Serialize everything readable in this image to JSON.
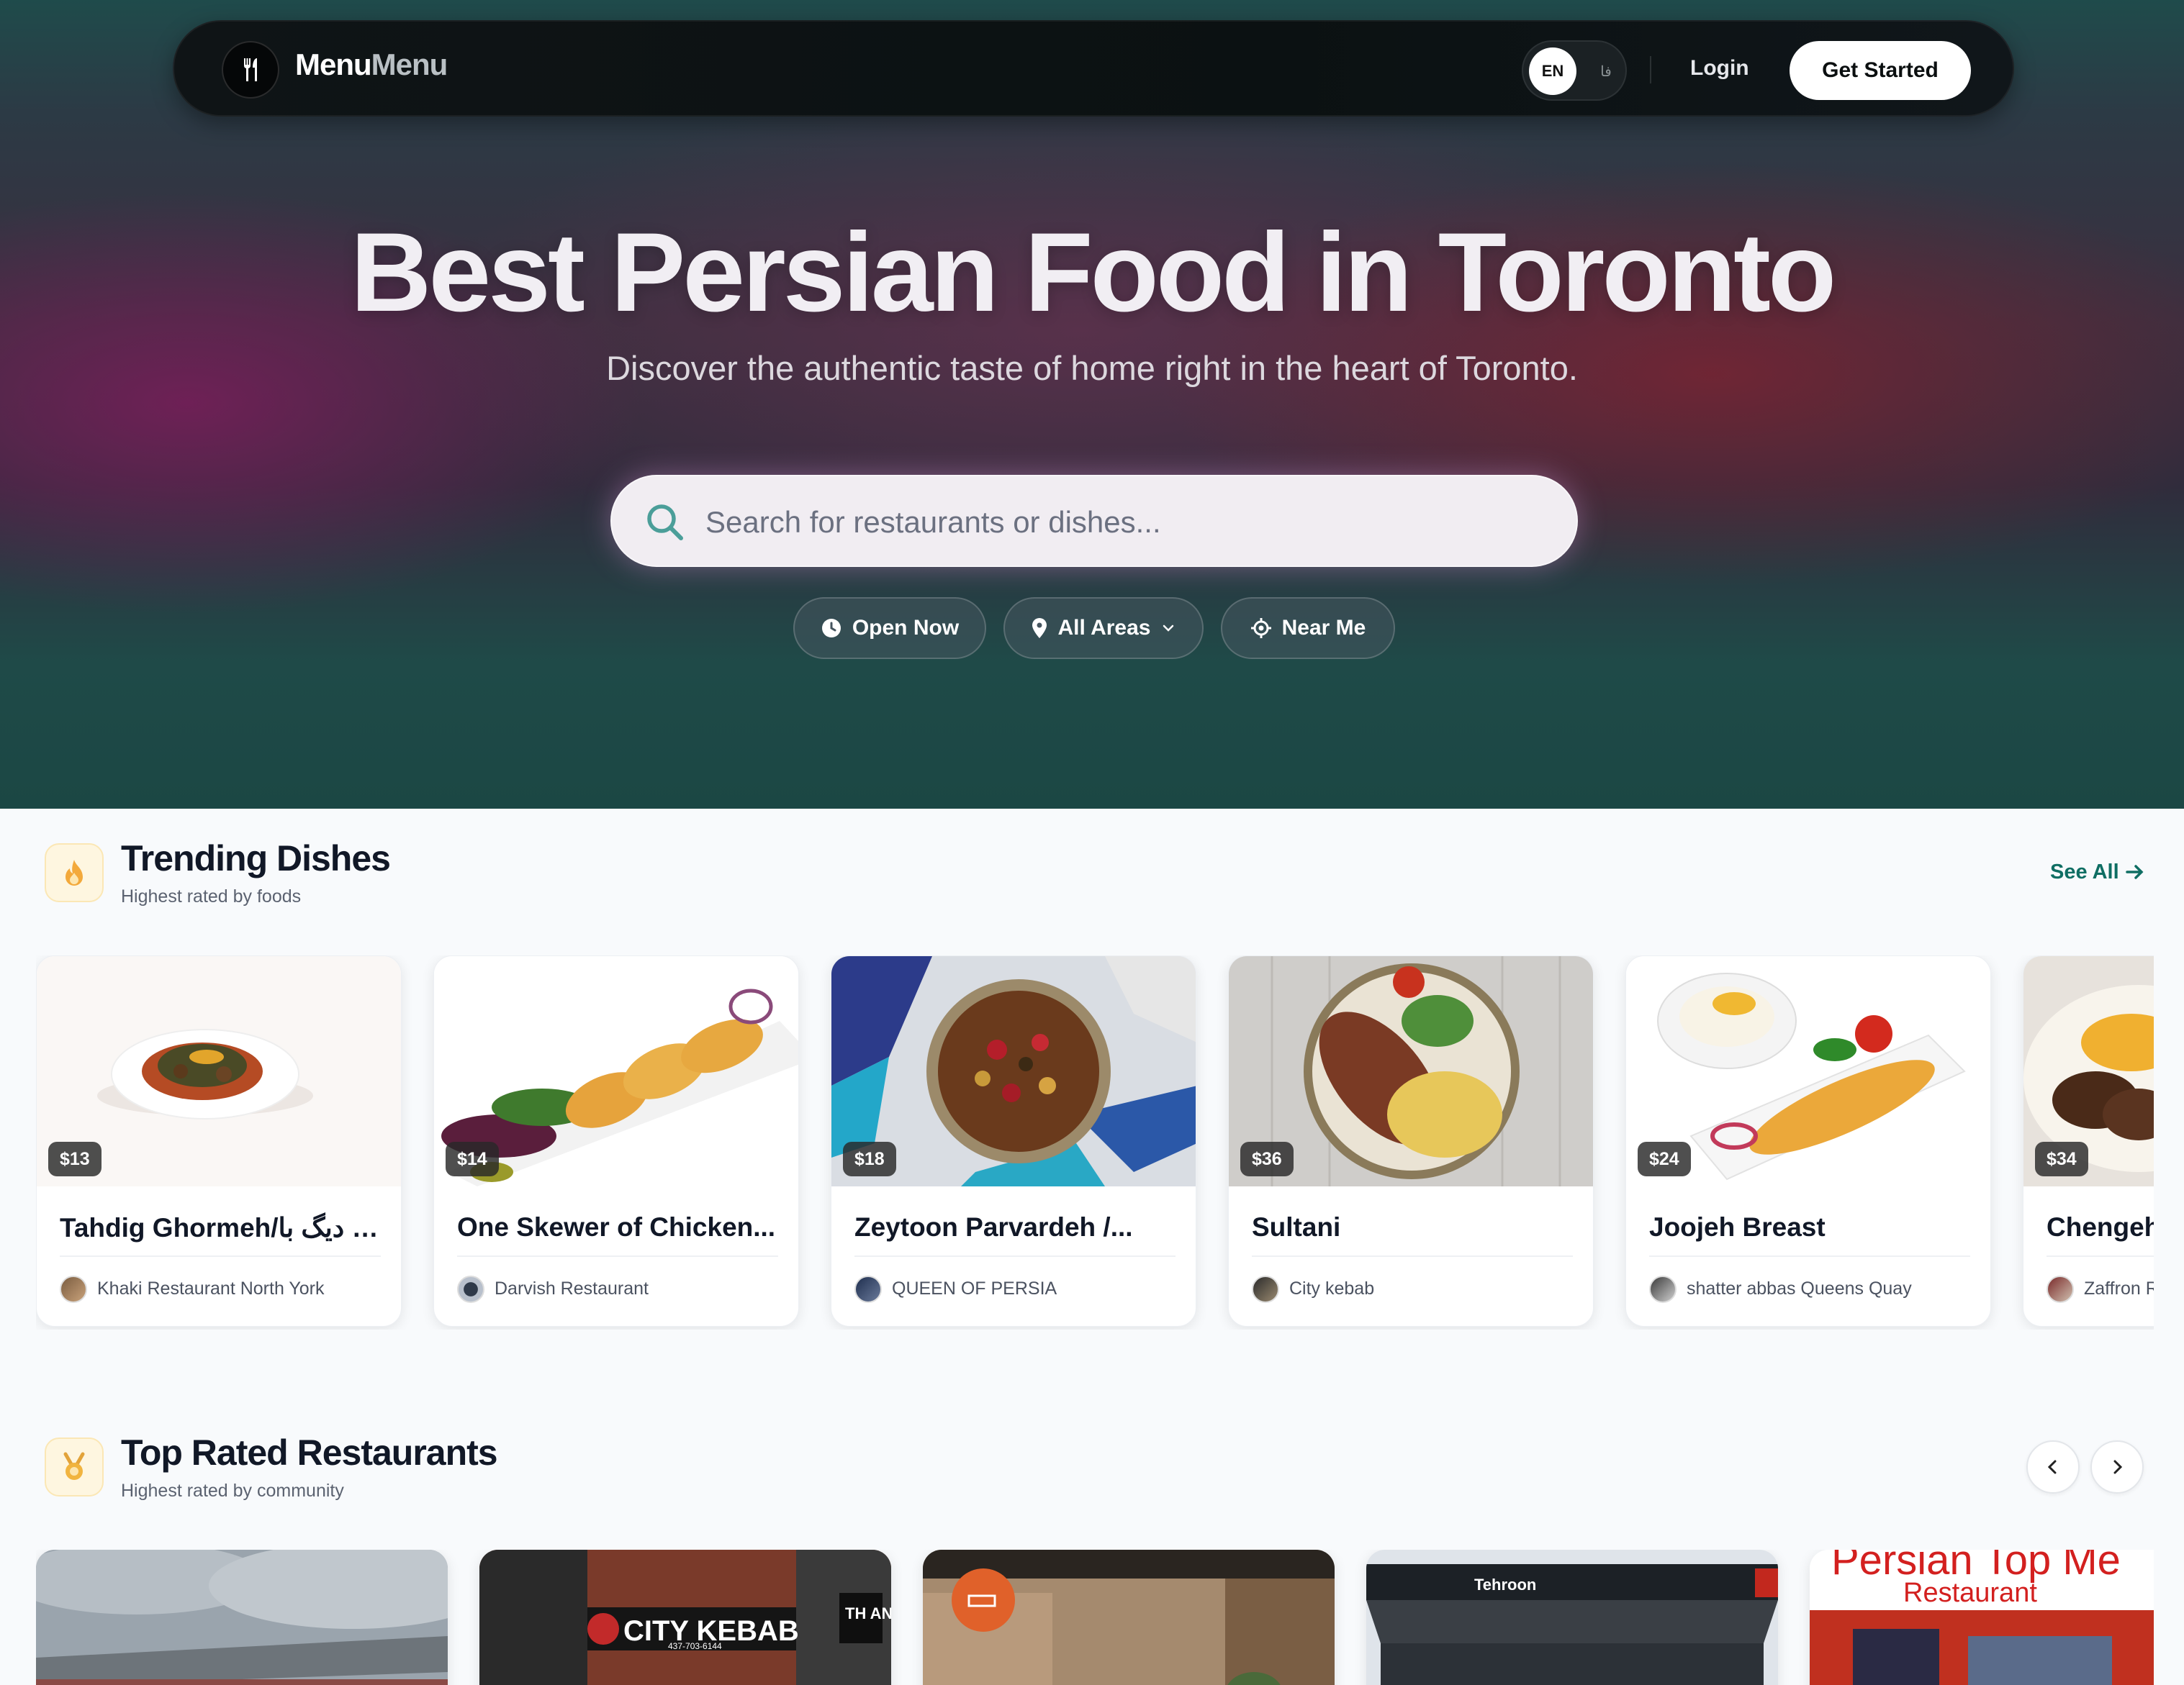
{
  "nav": {
    "brand_primary": "Menu",
    "brand_secondary": "Menu",
    "lang_en": "EN",
    "lang_fa": "فا",
    "login": "Login",
    "get_started": "Get Started"
  },
  "hero": {
    "title": "Best Persian Food in Toronto",
    "subtitle": "Discover the authentic taste of home right in the heart of Toronto.",
    "search_placeholder": "Search for restaurants or dishes...",
    "filters": {
      "open_now": "Open Now",
      "all_areas": "All Areas",
      "near_me": "Near Me"
    }
  },
  "trending": {
    "title": "Trending Dishes",
    "subtitle": "Highest rated by foods",
    "see_all": "See All",
    "dishes": [
      {
        "price": "$13",
        "name": "Tahdig Ghormeh/ته دیگ با...",
        "restaurant": "Khaki Restaurant North York"
      },
      {
        "price": "$14",
        "name": "One Skewer of Chicken...",
        "restaurant": "Darvish Restaurant"
      },
      {
        "price": "$18",
        "name": "Zeytoon Parvardeh /...",
        "restaurant": "QUEEN OF PERSIA"
      },
      {
        "price": "$36",
        "name": "Sultani",
        "restaurant": "City kebab"
      },
      {
        "price": "$24",
        "name": "Joojeh Breast",
        "restaurant": "shatter abbas Queens Quay"
      },
      {
        "price": "$34",
        "name": "Chengeh",
        "restaurant": "Zaffron Restaurant"
      }
    ]
  },
  "top_rated": {
    "title": "Top Rated Restaurants",
    "subtitle": "Highest rated by community",
    "cards": [
      {
        "sign": ""
      },
      {
        "sign": "CITY KEBAB",
        "phone": "437-703-6144",
        "side": "TH AN"
      },
      {
        "sign": ""
      },
      {
        "sign": "Tehroon"
      },
      {
        "sign": "Persian Top Me",
        "sub": "Restaurant"
      }
    ]
  },
  "colors": {
    "accent": "#0f6e63",
    "hero_title": "#f1eef3",
    "price_badge": "#2a2a2a"
  }
}
